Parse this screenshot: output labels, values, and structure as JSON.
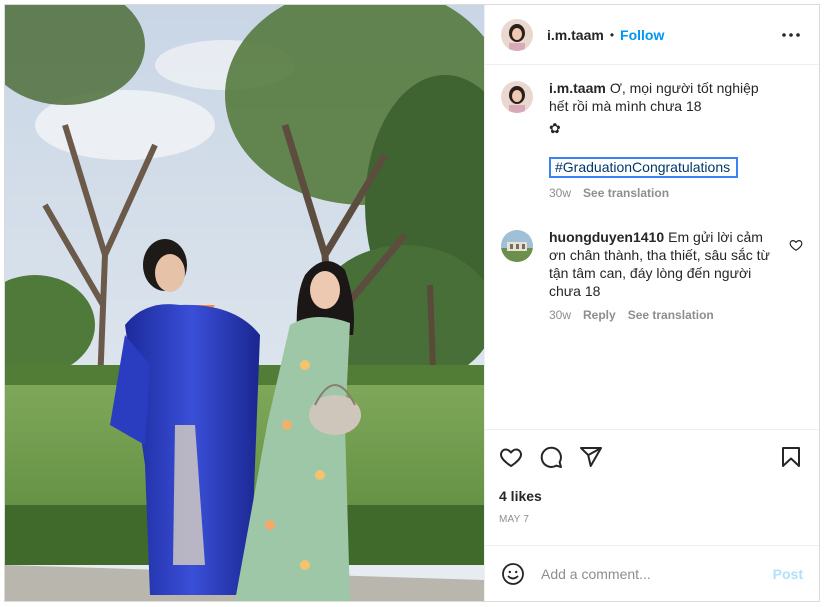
{
  "post": {
    "username": "i.m.taam",
    "follow_label": "Follow",
    "separator": "•",
    "more_icon": "more-horizontal-icon"
  },
  "caption": {
    "username": "i.m.taam",
    "text": "Ơ, mọi người tốt nghiệp hết rồi mà mình chưa 18",
    "flower": "✿",
    "hashtag": "#GraduationCongratulations",
    "age": "30w",
    "see_translation": "See translation"
  },
  "comment": {
    "username": "huongduyen1410",
    "text": "Em gửi lời cảm ơn chân thành, tha thiết, sâu sắc từ tận tâm can, đáy lòng đến người chưa 18",
    "age": "30w",
    "reply": "Reply",
    "see_translation": "See translation"
  },
  "actions": {
    "icons": [
      "heart-icon",
      "comment-icon",
      "share-icon",
      "bookmark-icon"
    ],
    "likes": "4 likes",
    "date": "MAY 7"
  },
  "add_comment": {
    "placeholder": "Add a comment...",
    "post_label": "Post"
  },
  "colors": {
    "link_blue": "#0095f6",
    "post_disabled": "#b2dffc",
    "muted": "#8e8e8e",
    "hashtag": "#00376b",
    "highlight_border": "#3b82f6"
  }
}
